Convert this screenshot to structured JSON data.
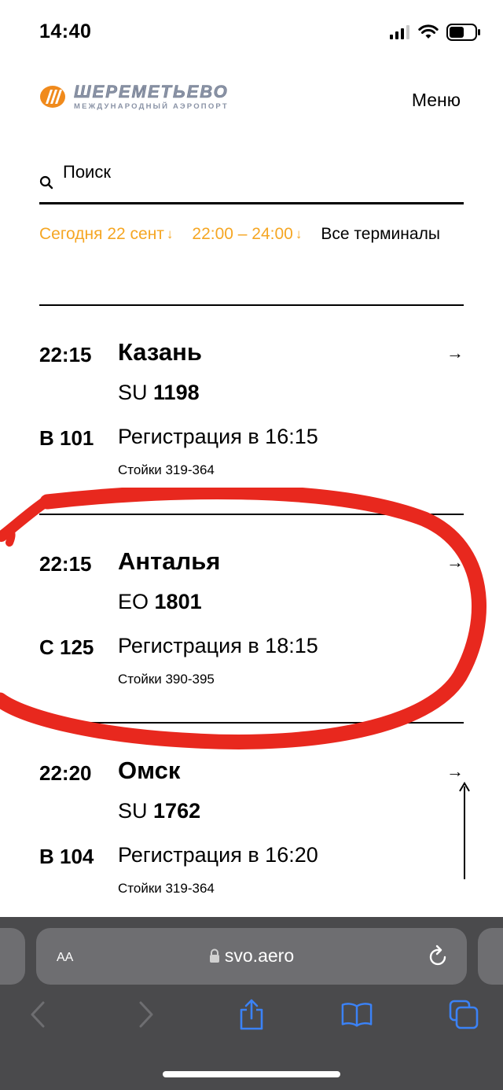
{
  "status_bar": {
    "time": "14:40"
  },
  "header": {
    "logo_title": "ШЕРЕМЕТЬЕВО",
    "logo_subtitle": "МЕЖДУНАРОДНЫЙ АЭРОПОРТ",
    "menu_label": "Меню"
  },
  "search": {
    "placeholder": "Поиск"
  },
  "filters": {
    "date": "Сегодня 22 сент",
    "time_range": "22:00 – 24:00",
    "terminals": "Все терминалы"
  },
  "flights": [
    {
      "time": "22:15",
      "city": "Казань",
      "airline": "SU",
      "number": "1198",
      "gate": "B 101",
      "registration": "Регистрация в 16:15",
      "counters": "Стойки 319-364"
    },
    {
      "time": "22:15",
      "city": "Анталья",
      "airline": "EO",
      "number": "1801",
      "gate": "C 125",
      "registration": "Регистрация в 18:15",
      "counters": "Стойки 390-395"
    },
    {
      "time": "22:20",
      "city": "Омск",
      "airline": "SU",
      "number": "1762",
      "gate": "B 104",
      "registration": "Регистрация в 16:20",
      "counters": "Стойки 319-364"
    }
  ],
  "browser": {
    "text_size_label": "AA",
    "url": "svo.aero"
  },
  "colors": {
    "accent": "#f5a623",
    "annotation": "#e8281e",
    "logo_orange": "#f08a1c",
    "browser_bar": "#4a4a4c",
    "icon_blue": "#3b82f6"
  },
  "icons": [
    "signal-icon",
    "wifi-icon",
    "battery-icon",
    "search-icon",
    "arrow-right-icon",
    "scroll-to-top-icon",
    "lock-icon",
    "reload-icon",
    "back-icon",
    "forward-icon",
    "share-icon",
    "bookmarks-icon",
    "tabs-icon"
  ]
}
